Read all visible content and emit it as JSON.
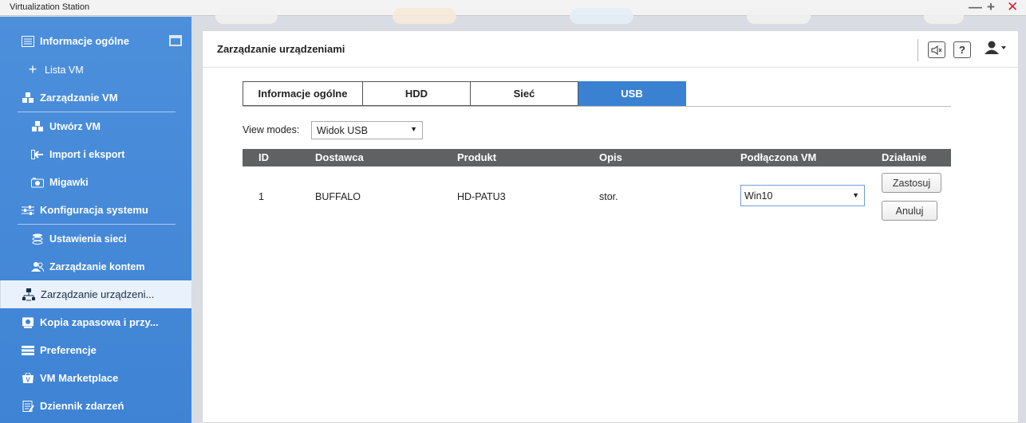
{
  "window": {
    "title": "Virtualization Station"
  },
  "sidebar": {
    "items": [
      {
        "label": "Informacje ogólne",
        "icon": "list-icon"
      },
      {
        "label": "Lista VM",
        "icon": "plus-icon"
      },
      {
        "label": "Zarządzanie VM",
        "icon": "cubes-icon"
      },
      {
        "label": "Utwórz VM",
        "icon": "cubes-icon"
      },
      {
        "label": "Import i eksport",
        "icon": "import-export-icon"
      },
      {
        "label": "Migawki",
        "icon": "camera-icon"
      },
      {
        "label": "Konfiguracja systemu",
        "icon": "sliders-icon"
      },
      {
        "label": "Ustawienia sieci",
        "icon": "database-icon"
      },
      {
        "label": "Zarządzanie kontem",
        "icon": "users-icon"
      },
      {
        "label": "Zarządzanie urządzeni...",
        "icon": "device-tree-icon"
      },
      {
        "label": "Kopia zapasowa i przy...",
        "icon": "backup-icon"
      },
      {
        "label": "Preferencje",
        "icon": "preferences-icon"
      },
      {
        "label": "VM Marketplace",
        "icon": "marketplace-icon"
      },
      {
        "label": "Dziennik zdarzeń",
        "icon": "log-icon"
      }
    ],
    "active_index": 9
  },
  "header": {
    "title": "Zarządzanie urządzeniami",
    "help_label": "?"
  },
  "tabs": [
    {
      "label": "Informacje ogólne"
    },
    {
      "label": "HDD"
    },
    {
      "label": "Sieć"
    },
    {
      "label": "USB"
    }
  ],
  "active_tab": "USB",
  "view_modes": {
    "label": "View modes:",
    "selected": "Widok USB"
  },
  "table": {
    "columns": [
      "ID",
      "Dostawca",
      "Produkt",
      "Opis",
      "Podłączona VM",
      "Działanie"
    ],
    "rows": [
      {
        "id": "1",
        "vendor": "BUFFALO",
        "product": "HD-PATU3",
        "description": "stor.",
        "connected_vm": "Win10",
        "apply_label": "Zastosuj",
        "cancel_label": "Anuluj"
      }
    ]
  },
  "colors": {
    "sidebar_bg": "#3f83d5",
    "active_tab": "#3a81d1",
    "table_header": "#5f6163",
    "close_red": "#d4232f"
  }
}
